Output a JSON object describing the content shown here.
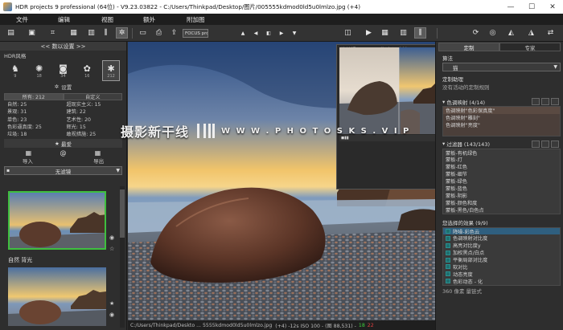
{
  "window": {
    "title": "HDR projects 9 professional (64位) - V9.23.03822 - C:/Users/Thinkpad/Desktop/图片/005555kdmod0ld5u0lmlzo.jpg (+4)",
    "minimize": "—",
    "maximize": "☐",
    "close": "✕"
  },
  "menu": [
    "文件",
    "编辑",
    "视图",
    "额外",
    "附加图"
  ],
  "toolbar": {
    "focus_label": "FOCUS pro"
  },
  "left": {
    "panel_title": "<<  数以设置  >>",
    "hdr_style_label": "HDR风格",
    "style_counts": [
      "9",
      "18",
      "34",
      "16",
      "212"
    ],
    "settings_label": "设置",
    "categories": [
      [
        "所有: 212",
        "自定义"
      ],
      [
        "自然: 25",
        "超现实主义: 15"
      ],
      [
        "景观: 31",
        "建筑: 22"
      ],
      [
        "单色: 23",
        "艺术性: 20"
      ],
      [
        "色彩逼真度: 25",
        "辉光: 15"
      ],
      [
        "垃圾: 18",
        "敢视措施: 25"
      ]
    ],
    "favorites_label": "最爱",
    "import_label": "导入",
    "export_label": "导出",
    "filter_value": "无滤镜",
    "preset_labels": [
      "自然 背光"
    ]
  },
  "compare": {
    "title": "比较视图 (HDR图像/色调映射)"
  },
  "watermark": {
    "cn_text": "摄影新干线",
    "url_text": "W W W . P H O T O S K S . V I P"
  },
  "status": {
    "path": "C:/Users/Thinkpad/Deskto ... 5555kdmod0ld5u0lmlzo.jpg",
    "info": "(+4)  -12s  ISO 100 -  (图 88,531)  -",
    "v1": "18",
    "v2": "22"
  },
  "right": {
    "tabs": [
      "定制",
      "专家"
    ],
    "algorithm_label": "算法",
    "algorithm_value": "猫",
    "processing_label": "定制助理",
    "processing_note": "没有活动的定制规则",
    "tonemap_header": "色调映射 (4/14)",
    "tonemap_items": [
      "色调映射\"色彩保真度\"",
      "色调映射\"雕刻\"",
      "色调映射\"亮度\""
    ],
    "filter_header": "过滤器 (143/143)",
    "filter_items": [
      "蒙板-有机绿色",
      "蒙板-灯",
      "蒙板-红色",
      "蒙板-细节",
      "蒙板-绿色",
      "蒙板-蓝色",
      "蒙板-阴影",
      "蒙板-颜色和度",
      "蒙板-黑色/白色点"
    ],
    "effects_header": "您选择的效果 (9/9)",
    "effects_items": [
      "降噪-彩色云",
      "色调映射对比度",
      "高亮对比度y",
      "加权黑点/白点",
      "平衡局部对比度",
      "软对比",
      "动态亮度",
      "色彩动态 - 化"
    ],
    "effects_footer": "360 像素 量链式"
  }
}
